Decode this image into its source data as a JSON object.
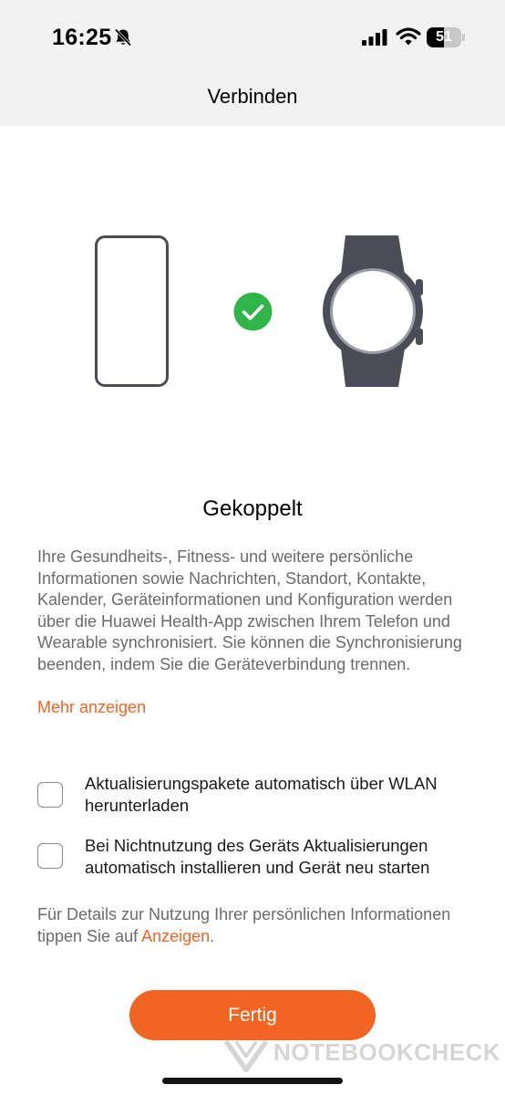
{
  "status_bar": {
    "time": "16:25",
    "battery_level": "51",
    "battery_fraction": 0.51,
    "icons": [
      "bell-slash-icon",
      "cellular-signal-icon",
      "wifi-icon",
      "battery-icon"
    ]
  },
  "header": {
    "title": "Verbinden"
  },
  "illustration": {
    "icons": [
      "phone-outline-icon",
      "check-circle-icon",
      "smartwatch-icon"
    ]
  },
  "main": {
    "status_title": "Gekoppelt",
    "description": "Ihre Gesundheits-, Fitness- und weitere persönliche Informationen sowie Nachrichten, Standort, Kontakte, Kalender, Geräteinformationen und Konfiguration werden über die Huawei Health-App zwischen Ihrem Telefon und Wearable synchronisiert. Sie können die Synchronisierung beenden, indem Sie die Geräteverbindung trennen.",
    "more_link": "Mehr anzeigen"
  },
  "options": [
    {
      "label": "Aktualisierungspakete automatisch über WLAN herunterladen",
      "checked": false
    },
    {
      "label": "Bei Nichtnutzung des Geräts Aktualisierungen automatisch installieren und Gerät neu starten",
      "checked": false
    }
  ],
  "footer": {
    "note_prefix": "Für Details zur Nutzung Ihrer persönlichen Informationen tippen Sie auf ",
    "note_link": "Anzeigen",
    "note_suffix": "."
  },
  "actions": {
    "done_label": "Fertig"
  },
  "watermark": {
    "text": "NOTEBOOKCHECK"
  },
  "colors": {
    "accent": "#f26422",
    "success": "#2fb54a",
    "device_gray": "#4a4d55",
    "header_bg": "#f2f2f2"
  }
}
